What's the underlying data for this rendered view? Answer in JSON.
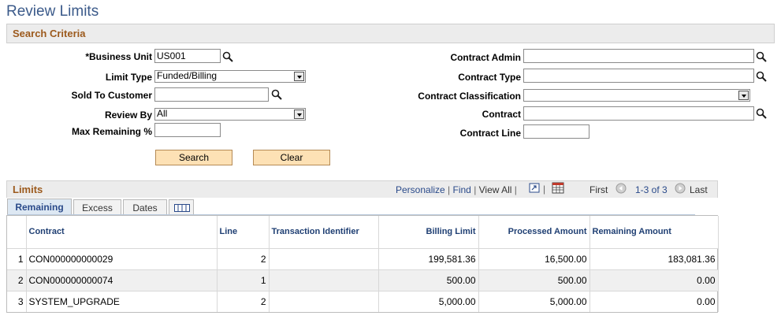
{
  "page": {
    "title": "Review Limits"
  },
  "search_criteria": {
    "title": "Search Criteria",
    "business_unit": {
      "label": "*Business Unit",
      "value": "US001",
      "lookup_icon": "search-icon"
    },
    "limit_type": {
      "label": "Limit Type",
      "value": "Funded/Billing"
    },
    "sold_to_customer": {
      "label": "Sold To Customer",
      "value": ""
    },
    "review_by": {
      "label": "Review By",
      "value": "All"
    },
    "max_remaining": {
      "label": "Max Remaining %",
      "value": ""
    },
    "contract_admin": {
      "label": "Contract Admin",
      "value": ""
    },
    "contract_type": {
      "label": "Contract Type",
      "value": ""
    },
    "contract_classification": {
      "label": "Contract Classification",
      "value": ""
    },
    "contract": {
      "label": "Contract",
      "value": ""
    },
    "contract_line": {
      "label": "Contract Line",
      "value": ""
    },
    "search_button": "Search",
    "clear_button": "Clear"
  },
  "limits_grid": {
    "title": "Limits",
    "personalize": "Personalize",
    "find": "Find",
    "view_all": "View All",
    "first": "First",
    "range": "1-3 of 3",
    "last": "Last",
    "tabs": [
      "Remaining",
      "Excess",
      "Dates"
    ],
    "active_tab": "Remaining",
    "columns": [
      "Contract",
      "Line",
      "Transaction Identifier",
      "Billing Limit",
      "Processed Amount",
      "Remaining Amount"
    ],
    "rows": [
      {
        "num": "1",
        "contract": "CON000000000029",
        "line": "2",
        "transaction_identifier": "",
        "billing_limit": "199,581.36",
        "processed_amount": "16,500.00",
        "remaining_amount": "183,081.36"
      },
      {
        "num": "2",
        "contract": "CON000000000074",
        "line": "1",
        "transaction_identifier": "",
        "billing_limit": "500.00",
        "processed_amount": "500.00",
        "remaining_amount": "0.00"
      },
      {
        "num": "3",
        "contract": "SYSTEM_UPGRADE",
        "line": "2",
        "transaction_identifier": "",
        "billing_limit": "5,000.00",
        "processed_amount": "5,000.00",
        "remaining_amount": "0.00"
      }
    ]
  },
  "colors": {
    "title": "#3b5a8a",
    "section_title": "#9c5a1d",
    "button_bg": "#fde1b5",
    "link": "#2a4a8a"
  }
}
